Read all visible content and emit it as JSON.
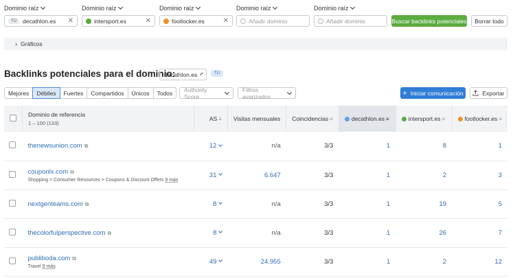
{
  "domains": [
    {
      "label": "Dominio raíz",
      "value": "decathlon.es",
      "color": "#57a3f0",
      "is_you": true,
      "you_label": "TÚ"
    },
    {
      "label": "Dominio raíz",
      "value": "intersport.es",
      "color": "#5bac3f"
    },
    {
      "label": "Dominio raíz",
      "value": "footlocker.es",
      "color": "#f0902f"
    },
    {
      "label": "Dominio raíz",
      "placeholder": "Añadir dominio"
    },
    {
      "label": "Dominio raíz",
      "placeholder": "Añadir dominio"
    }
  ],
  "buttons": {
    "search": "Buscar backlinks potenciales",
    "clear": "Borrar todo",
    "start_comm": "Iniciar comunicación",
    "export": "Exportar"
  },
  "graficos": "Gráficos",
  "main": {
    "title": "Backlinks potenciales para el dominio:",
    "domain_select": "decathlon.es",
    "you_badge": "TÚ"
  },
  "tabs": [
    "Mejores",
    "Débiles",
    "Fuertes",
    "Compartidos",
    "Únicos",
    "Todos"
  ],
  "filters": {
    "authority": "Authority Score",
    "advanced": "Filtros avanzados"
  },
  "table": {
    "headers": {
      "domain": "Dominio de referencia",
      "range": "1 – 100 (133)",
      "as": "AS",
      "visits": "Visitas mensuales",
      "matches": "Coincidencias",
      "d1": "decathlon.es",
      "d2": "intersport.es",
      "d3": "footlocker.es"
    },
    "rows": [
      {
        "domain": "thenewsunion.com",
        "category": "",
        "more": "",
        "as": "12",
        "visits": "n/a",
        "matches": "3/3",
        "d1": "1",
        "d2": "8",
        "d3": "1"
      },
      {
        "domain": "couponlx.com",
        "category": "Shopping > Consumer Resources > Coupons & Discount Offers",
        "more": "9 más",
        "as": "31",
        "visits": "6.647",
        "matches": "3/3",
        "d1": "1",
        "d2": "2",
        "d3": "3"
      },
      {
        "domain": "nextgenteams.com",
        "category": "",
        "more": "",
        "as": "8",
        "visits": "n/a",
        "matches": "3/3",
        "d1": "1",
        "d2": "19",
        "d3": "5"
      },
      {
        "domain": "thecolorfulperspective.com",
        "category": "",
        "more": "",
        "as": "8",
        "visits": "n/a",
        "matches": "3/3",
        "d1": "1",
        "d2": "26",
        "d3": "7"
      },
      {
        "domain": "publiboda.com",
        "category": "Travel",
        "more": "9 más",
        "as": "49",
        "visits": "24.955",
        "matches": "3/3",
        "d1": "1",
        "d2": "2",
        "d3": "12"
      }
    ]
  }
}
